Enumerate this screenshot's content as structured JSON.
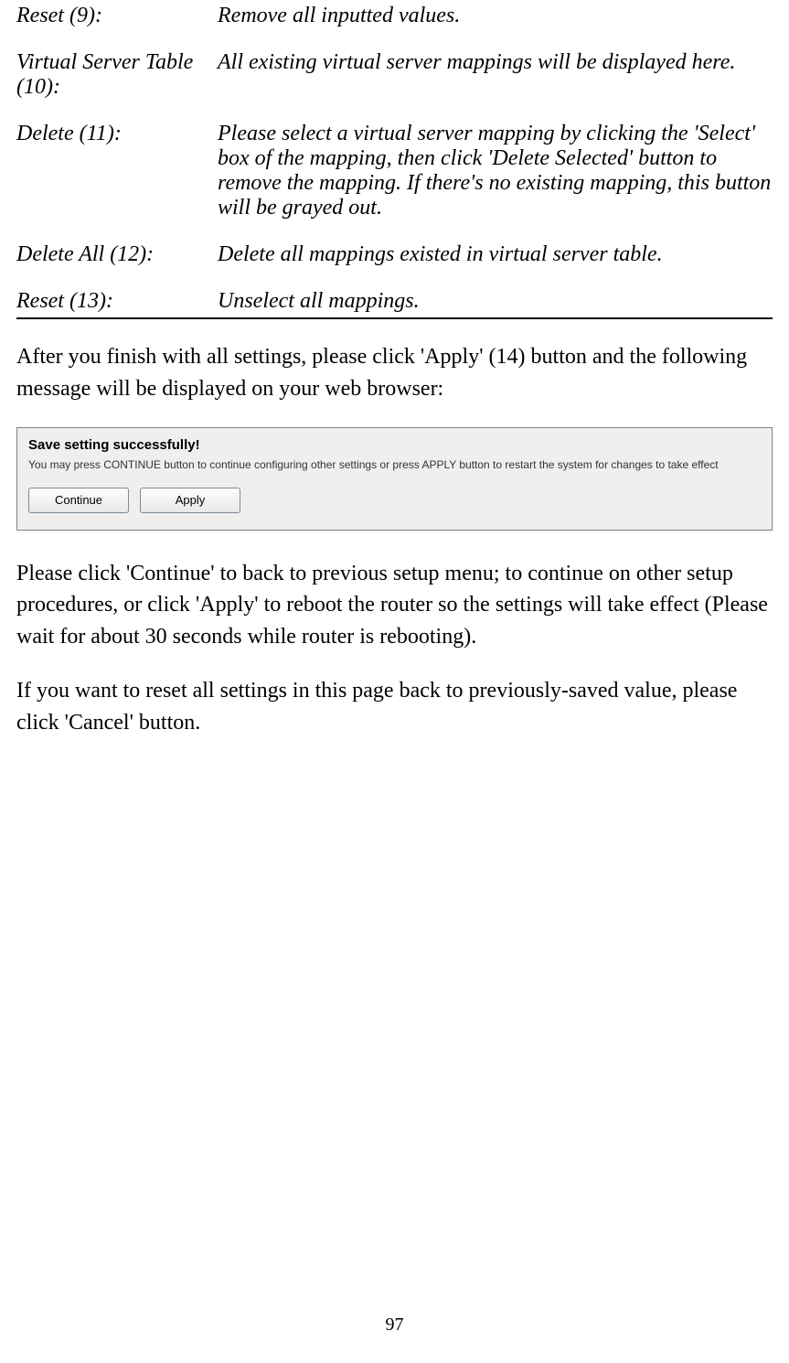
{
  "defs": [
    {
      "label": "Reset (9):",
      "desc": "Remove all inputted values."
    },
    {
      "label": "Virtual Server Table (10):",
      "desc": "All existing virtual server mappings will be displayed here."
    },
    {
      "label": "Delete (11):",
      "desc": "Please select a virtual server mapping by clicking the 'Select' box of the mapping, then click 'Delete Selected' button to remove the mapping. If there's no existing mapping, this button will be grayed out."
    },
    {
      "label": "Delete All (12):",
      "desc": "Delete all mappings existed in virtual server table."
    },
    {
      "label": "Reset (13):",
      "desc": "Unselect all mappings."
    }
  ],
  "para1": "After you finish with all settings, please click 'Apply' (14) button and the following message will be displayed on your web browser:",
  "dialog": {
    "title": "Save setting successfully!",
    "message": "You may press CONTINUE button to continue configuring other settings or press APPLY button to restart the system for changes to take effect",
    "continue_label": "Continue",
    "apply_label": "Apply"
  },
  "para2": "Please click 'Continue' to back to previous setup menu; to continue on other setup procedures, or click 'Apply' to reboot the router so the settings will take effect (Please wait for about 30 seconds while router is rebooting).",
  "para3": "If you want to reset all settings in this page back to previously-saved value, please click 'Cancel' button.",
  "page_number": "97"
}
